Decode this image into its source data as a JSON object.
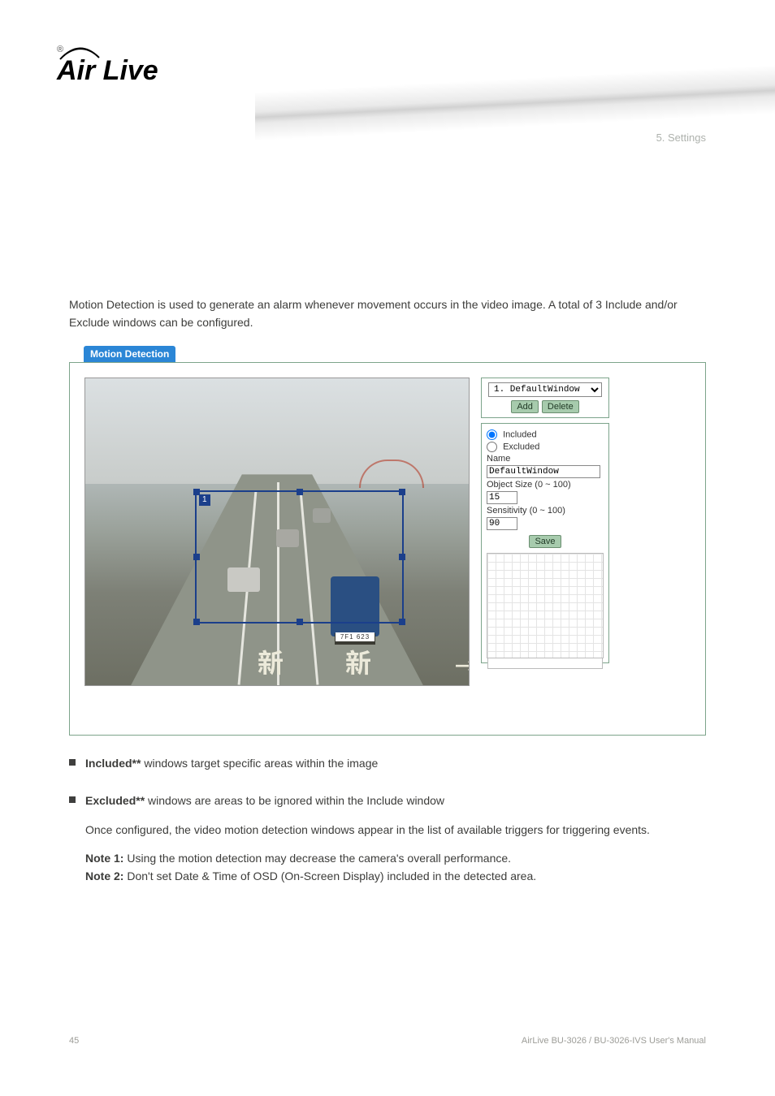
{
  "logo_text": "Air Live",
  "section_heading": "5. Settings",
  "intro": "Motion Detection is used to generate an alarm whenever movement occurs in the video image. A total of 3 Include and/or Exclude windows can be configured.",
  "tab_label": "Motion Detection",
  "panel": {
    "window_select": "1. DefaultWindow",
    "add_btn": "Add",
    "delete_btn": "Delete",
    "included_label": "Included",
    "excluded_label": "Excluded",
    "name_label": "Name",
    "name_value": "DefaultWindow",
    "size_label": "Object Size  (0 ~ 100)",
    "size_value": "15",
    "sens_label": "Sensitivity  (0 ~ 100)",
    "sens_value": "90",
    "save_btn": "Save"
  },
  "video": {
    "roi_number": "1",
    "plate": "7F1   623",
    "cjk_left": "新",
    "cjk_right": "新"
  },
  "bullets": [
    {
      "title": "Included** ",
      "body": "windows target specific areas within the image"
    },
    {
      "title": "Excluded** ",
      "body": "windows are areas to be ignored within the Include window"
    }
  ],
  "post_bullet": "Once configured, the video motion detection windows appear in the list of available triggers for triggering events.",
  "notes": {
    "note1_label": "Note 1:",
    "note1_body": " Using the motion detection may decrease the camera's overall performance.",
    "note2_label": "Note 2:",
    "note2_body": " Don't set Date & Time of OSD (On-Screen Display) included in the detected area."
  },
  "pagenum": "45",
  "footer_line1": "AirLive BU-3026 / BU-3026-IVS User's Manual"
}
